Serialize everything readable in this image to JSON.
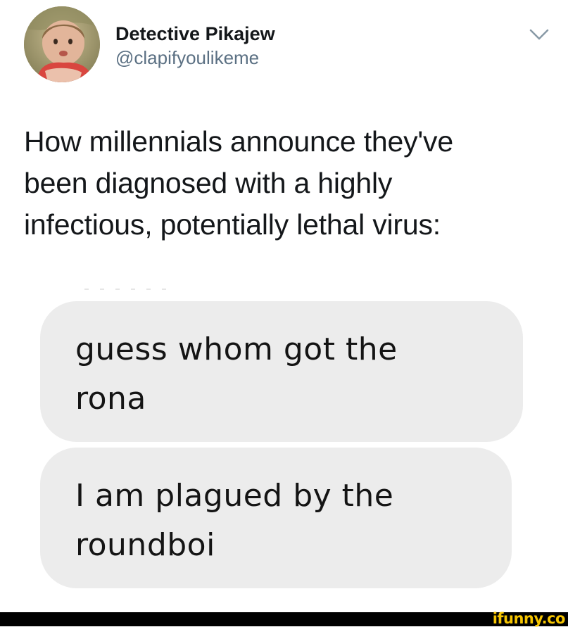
{
  "tweet": {
    "author": {
      "display_name": "Detective Pikajew",
      "handle": "@clapifyoulikeme",
      "avatar_icon": "profile-photo-icon"
    },
    "menu_icon": "chevron-down-icon",
    "text_lines": [
      "How millennials announce they've",
      "been diagnosed with a highly",
      "infectious, potentially lethal virus:"
    ],
    "embedded_messages": [
      {
        "lines": [
          "guess whom got the",
          "rona"
        ]
      },
      {
        "lines": [
          "I am plagued by the",
          "roundboi"
        ]
      }
    ]
  },
  "watermark": {
    "text": "ifunny.co",
    "color": "#f5c400"
  },
  "colors": {
    "text": "#14171a",
    "handle": "#5b7083",
    "bubble": "#ececec",
    "footer": "#000000"
  }
}
